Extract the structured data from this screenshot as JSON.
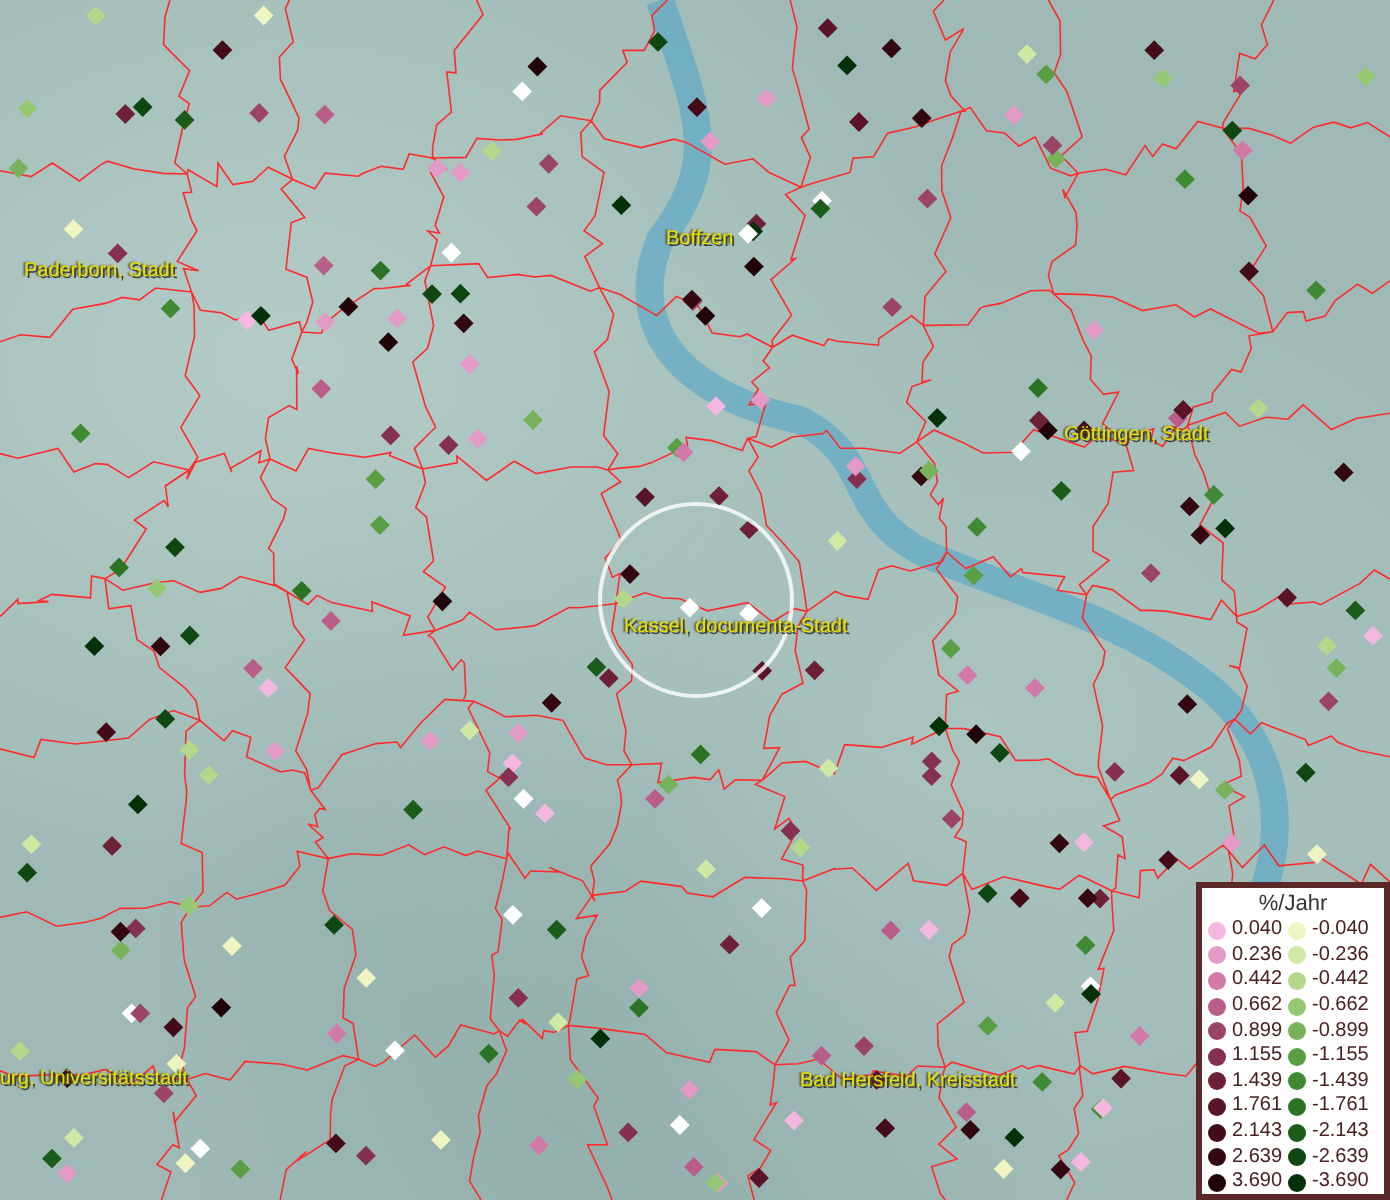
{
  "map": {
    "places": [
      {
        "label": "Paderborn, Stadt"
      },
      {
        "label": "Boffzen"
      },
      {
        "label": "Göttingen, Stadt"
      },
      {
        "label": "Kassel, documenta-Stadt"
      },
      {
        "label": "urg, Universitätsstadt"
      },
      {
        "label": "Bad Hersfeld, Kreisstadt"
      }
    ]
  },
  "legend": {
    "title": "%/Jahr",
    "rows": [
      {
        "pos": {
          "label": "0.040",
          "color": "#f4b8e0"
        },
        "neg": {
          "label": "-0.040",
          "color": "#eef5c0"
        }
      },
      {
        "pos": {
          "label": "0.236",
          "color": "#e49ac6"
        },
        "neg": {
          "label": "-0.236",
          "color": "#cfe8a4"
        }
      },
      {
        "pos": {
          "label": "0.442",
          "color": "#d17aa8"
        },
        "neg": {
          "label": "-0.442",
          "color": "#b2d98a"
        }
      },
      {
        "pos": {
          "label": "0.662",
          "color": "#b85e88"
        },
        "neg": {
          "label": "-0.662",
          "color": "#96c874"
        }
      },
      {
        "pos": {
          "label": "0.899",
          "color": "#9c4468"
        },
        "neg": {
          "label": "-0.899",
          "color": "#78b35c"
        }
      },
      {
        "pos": {
          "label": "1.155",
          "color": "#853050"
        },
        "neg": {
          "label": "-1.155",
          "color": "#5a9e44"
        }
      },
      {
        "pos": {
          "label": "1.439",
          "color": "#6e2038"
        },
        "neg": {
          "label": "-1.439",
          "color": "#3f8a32"
        }
      },
      {
        "pos": {
          "label": "1.761",
          "color": "#5a1428"
        },
        "neg": {
          "label": "-1.761",
          "color": "#2a7424"
        }
      },
      {
        "pos": {
          "label": "2.143",
          "color": "#440c18"
        },
        "neg": {
          "label": "-2.143",
          "color": "#1a5c18"
        }
      },
      {
        "pos": {
          "label": "2.639",
          "color": "#330810"
        },
        "neg": {
          "label": "-2.639",
          "color": "#0e4810"
        }
      },
      {
        "pos": {
          "label": "3.690",
          "color": "#200408"
        },
        "neg": {
          "label": "-3.690",
          "color": "#053008"
        }
      }
    ]
  }
}
